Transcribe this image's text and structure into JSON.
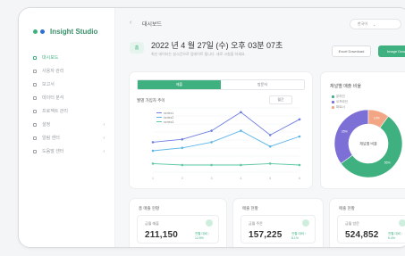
{
  "app": {
    "title": "Insight Studio",
    "logo_dots": [
      "#3fb07f",
      "#2f6fd1"
    ]
  },
  "sidebar": {
    "items": [
      {
        "label": "대시보드",
        "active": true,
        "chevron": ""
      },
      {
        "label": "사용자 관리",
        "active": false,
        "chevron": ""
      },
      {
        "label": "보고서",
        "active": false,
        "chevron": ""
      },
      {
        "label": "데이터 분석",
        "active": false,
        "chevron": ""
      },
      {
        "label": "프로젝트 관리",
        "active": false,
        "chevron": ""
      },
      {
        "label": "설정",
        "active": false,
        "chevron": "›"
      },
      {
        "label": "알림 센터",
        "active": false,
        "chevron": "›"
      },
      {
        "label": "도움말 센터",
        "active": false,
        "chevron": "›"
      }
    ]
  },
  "topbar": {
    "back_icon": "‹",
    "breadcrumb": "대시보드",
    "language": "한국어",
    "caret": "⌄"
  },
  "hero": {
    "badge": "홈",
    "title": "2022 년 4 월 27일 (수) 오후 03분 07초",
    "subtitle": "최신 데이터는 실시간으로 업데이트 됩니다. 새로 고침을 하세요.",
    "buttons": {
      "outline": "Excel Download",
      "filled": "Image Download"
    }
  },
  "chart_card": {
    "tabs": [
      "매출",
      "방문자"
    ],
    "active_tab": 0,
    "title": "월별 가입자 추이",
    "filter": "월간",
    "legend": [
      "series1",
      "series2",
      "series3"
    ],
    "colors": [
      "#6f7fe0",
      "#5bb6e8",
      "#5dc9a6"
    ]
  },
  "chart_data": {
    "type": "line",
    "categories": [
      "1",
      "2",
      "3",
      "4",
      "5",
      "6"
    ],
    "series": [
      {
        "name": "series1",
        "values": [
          62,
          66,
          78,
          104,
          72,
          94
        ]
      },
      {
        "name": "series2",
        "values": [
          50,
          54,
          62,
          78,
          56,
          70
        ]
      },
      {
        "name": "series3",
        "values": [
          32,
          30,
          30,
          30,
          32,
          30
        ]
      }
    ],
    "ylim": [
      20,
      110
    ],
    "grid": true,
    "legend_position": "top-left"
  },
  "donut_card": {
    "title": "채널별 매출 비율",
    "center_label": "채널별 비율",
    "legend": [
      "온라인",
      "오프라인",
      "파트너"
    ],
    "slices": [
      {
        "label": "온라인",
        "value": 55,
        "color": "#3fb07f"
      },
      {
        "label": "오프라인",
        "value": 35,
        "color": "#7c6fd6"
      },
      {
        "label": "파트너",
        "value": 10,
        "color": "#f3a684"
      }
    ],
    "slice_labels": [
      "55%",
      "35%",
      "10%"
    ]
  },
  "stats": [
    {
      "label": "총 매출 현황",
      "sub": "금월 매출",
      "value": "211,150",
      "delta": "전월 대비 ↑ 12.5%"
    },
    {
      "label": "매출 현황",
      "sub": "금월 주문",
      "value": "157,225",
      "delta": "전월 대비 ↑ 8.1%"
    },
    {
      "label": "매출 현황",
      "sub": "금월 방문",
      "value": "524,852",
      "delta": "전월 대비 ↑ 5.4%"
    }
  ]
}
